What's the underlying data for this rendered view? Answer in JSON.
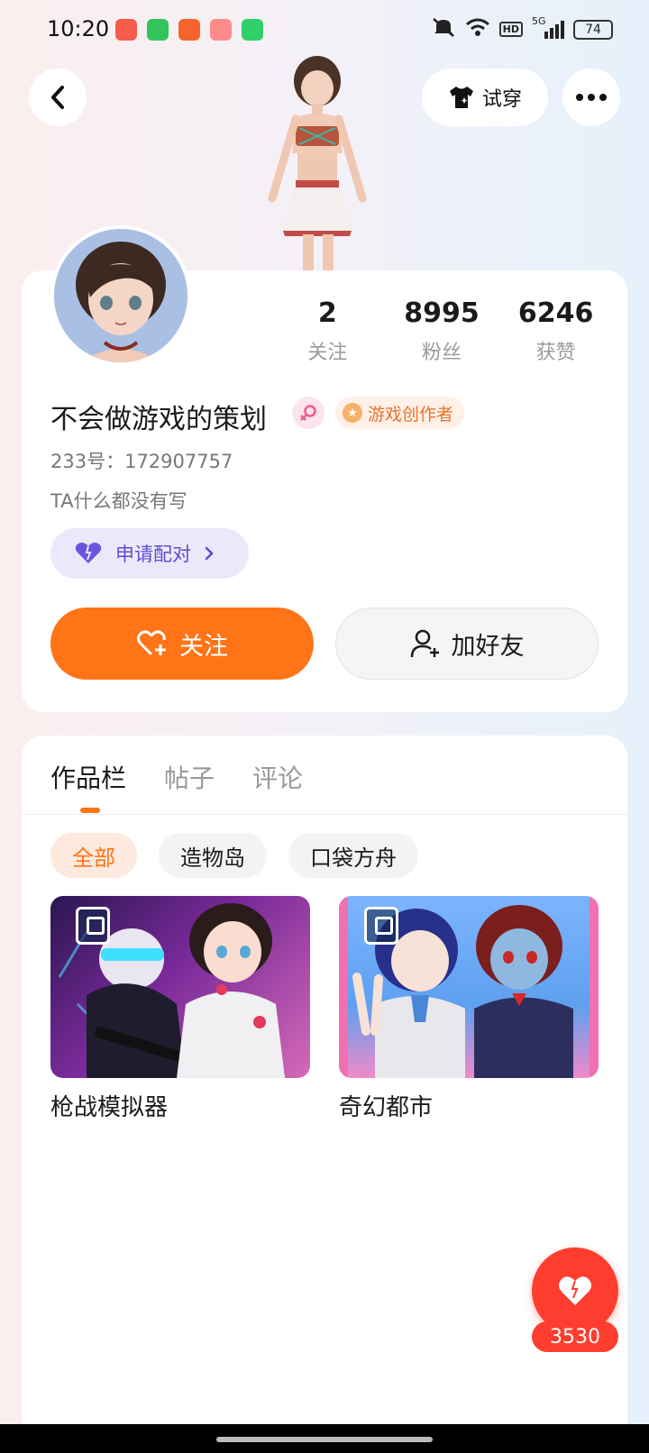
{
  "status_bar": {
    "time": "10:20",
    "network": "5G",
    "hd": "HD",
    "battery": "74",
    "app_icons": [
      "#f45b4a",
      "#31c45a",
      "#f5652b",
      "#ff6a6a",
      "#2fcf6a"
    ]
  },
  "header": {
    "try_on_label": "试穿"
  },
  "profile": {
    "nickname": "不会做游戏的策划",
    "creator_badge": "游戏创作者",
    "uid": "233号：172907757",
    "bio": "TA什么都没有写",
    "pair_button": "申请配对",
    "stats": [
      {
        "value": "2",
        "label": "关注"
      },
      {
        "value": "8995",
        "label": "粉丝"
      },
      {
        "value": "6246",
        "label": "获赞"
      }
    ],
    "follow_button": "关注",
    "add_friend_button": "加好友"
  },
  "works": {
    "tabs": [
      "作品栏",
      "帖子",
      "评论"
    ],
    "active_tab": 0,
    "chips": [
      "全部",
      "造物岛",
      "口袋方舟"
    ],
    "items": [
      {
        "title": "枪战模拟器"
      },
      {
        "title": "奇幻都市"
      }
    ]
  },
  "like": {
    "count": "3530"
  },
  "colors": {
    "accent": "#ff7417",
    "like": "#ff3d2e",
    "pair": "#5a4fcf"
  }
}
